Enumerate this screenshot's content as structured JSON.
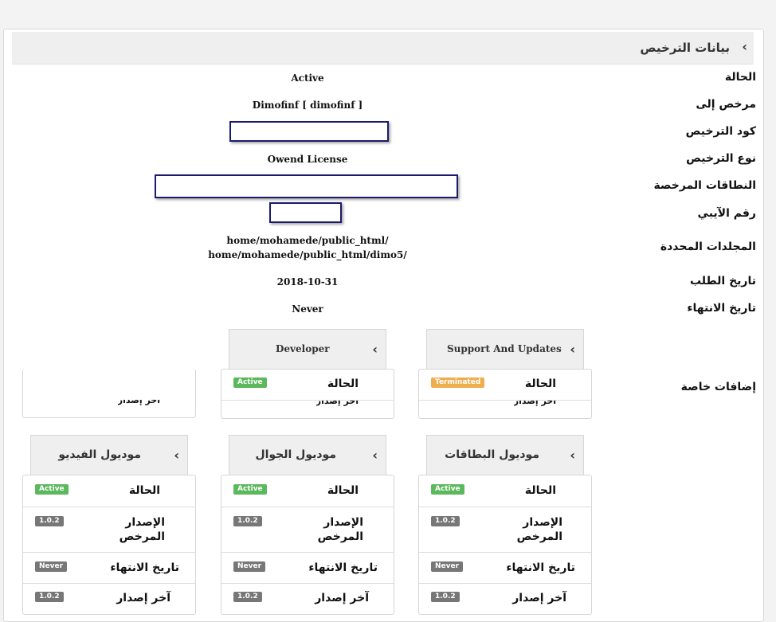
{
  "panel": {
    "title": "بيانات الترخيص"
  },
  "fields": {
    "status": {
      "label": "الحالة",
      "value": "Active"
    },
    "licensed_to": {
      "label": "مرخص إلى",
      "value": "Dimofinf [ dimofinf ]"
    },
    "license_code": {
      "label": "كود الترخيص"
    },
    "license_type": {
      "label": "نوع الترخيص",
      "value": "Owend License"
    },
    "domains": {
      "label": "النطاقات المرخصة"
    },
    "ip": {
      "label": "رقم الآيبي"
    },
    "dirs": {
      "label": "المجلدات المحددة",
      "values": [
        "home/mohamede/public_html/",
        "home/mohamede/public_html/dimo5/"
      ]
    },
    "order_date": {
      "label": "تاريخ الطلب",
      "value": "2018-10-31"
    },
    "expiry": {
      "label": "تاريخ الانتهاء",
      "value": "Never"
    },
    "addons": {
      "label": "إضافات خاصة"
    }
  },
  "addon_cards": [
    {
      "title": "Support And Updates",
      "status_label": "الحالة",
      "status": "Terminated",
      "status_color": "#f0ad4e",
      "clipped": "آخر إصدار"
    },
    {
      "title": "Developer",
      "status_label": "الحالة",
      "status": "Active",
      "status_color": "#5cb85c",
      "clipped": "آخر إصدار"
    },
    {
      "clipped": "آخر إصدار"
    }
  ],
  "module_cards": [
    {
      "title": "موديول البطاقات",
      "status_label": "الحالة",
      "status": "Active",
      "version_label": "الإصدار المرخص",
      "version": "1.0.2",
      "expiry_label": "تاريخ الانتهاء",
      "expiry": "Never",
      "latest_label": "آخر إصدار",
      "latest": "1.0.2"
    },
    {
      "title": "موديول الجوال",
      "status_label": "الحالة",
      "status": "Active",
      "version_label": "الإصدار المرخص",
      "version": "1.0.2",
      "expiry_label": "تاريخ الانتهاء",
      "expiry": "Never",
      "latest_label": "آخر إصدار",
      "latest": "1.0.2"
    },
    {
      "title": "موديول الفيديو",
      "status_label": "الحالة",
      "status": "Active",
      "version_label": "الإصدار المرخص",
      "version": "1.0.2",
      "expiry_label": "تاريخ الانتهاء",
      "expiry": "Never",
      "latest_label": "آخر إصدار",
      "latest": "1.0.2"
    }
  ],
  "icons": {
    "chevron": "chevron-left-icon"
  }
}
